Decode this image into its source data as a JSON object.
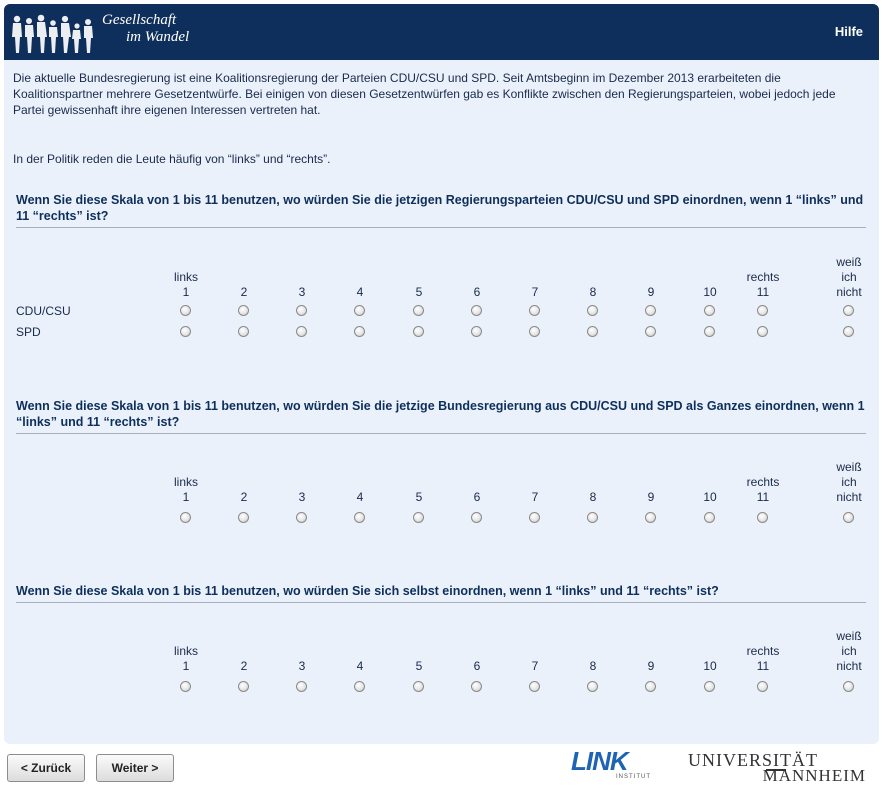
{
  "header": {
    "logo_line1": "Gesellschaft",
    "logo_line2": "im Wandel",
    "help_label": "Hilfe"
  },
  "intro_text": "Die aktuelle Bundesregierung ist eine Koalitionsregierung der Parteien CDU/CSU und SPD. Seit Amtsbeginn im Dezember 2013 erarbeiteten die Koalitionspartner mehrere Gesetzentwürfe. Bei einigen von diesen Gesetzentwürfen gab es Konflikte zwischen den Regierungsparteien, wobei jedoch jede Partei gewissenhaft ihre eigenen Interessen vertreten hat.",
  "politik_text": "In der Politik reden die Leute häufig von “links” und “rechts”.",
  "scale": {
    "columns": [
      {
        "label": "links",
        "number": "1"
      },
      {
        "label": "",
        "number": "2"
      },
      {
        "label": "",
        "number": "3"
      },
      {
        "label": "",
        "number": "4"
      },
      {
        "label": "",
        "number": "5"
      },
      {
        "label": "",
        "number": "6"
      },
      {
        "label": "",
        "number": "7"
      },
      {
        "label": "",
        "number": "8"
      },
      {
        "label": "",
        "number": "9"
      },
      {
        "label": "",
        "number": "10"
      },
      {
        "label": "rechts",
        "number": "11"
      }
    ],
    "dont_know": [
      "weiß",
      "ich",
      "nicht"
    ]
  },
  "questions": [
    {
      "text": "Wenn Sie diese Skala von 1 bis 11 benutzen, wo würden Sie die jetzigen Regierungsparteien CDU/CSU und SPD einordnen, wenn 1 “links” und 11 “rechts” ist?",
      "rows": [
        "CDU/CSU",
        "SPD"
      ]
    },
    {
      "text": "Wenn Sie diese Skala von 1 bis 11 benutzen, wo würden Sie die jetzige Bundesregierung aus CDU/CSU und SPD als Ganzes einordnen, wenn 1 “links” und 11 “rechts” ist?",
      "rows": [
        ""
      ]
    },
    {
      "text": "Wenn Sie diese Skala von 1 bis 11 benutzen, wo würden Sie sich selbst einordnen, wenn 1 “links” und 11 “rechts” ist?",
      "rows": [
        ""
      ]
    }
  ],
  "nav": {
    "back_label": "< Zurück",
    "next_label": "Weiter >"
  },
  "footer": {
    "link_logo": "LINK",
    "link_sub": "INSTITUT",
    "uni_line1": "UNIVERSITÄT",
    "uni_line2": "MANNHEIM"
  }
}
